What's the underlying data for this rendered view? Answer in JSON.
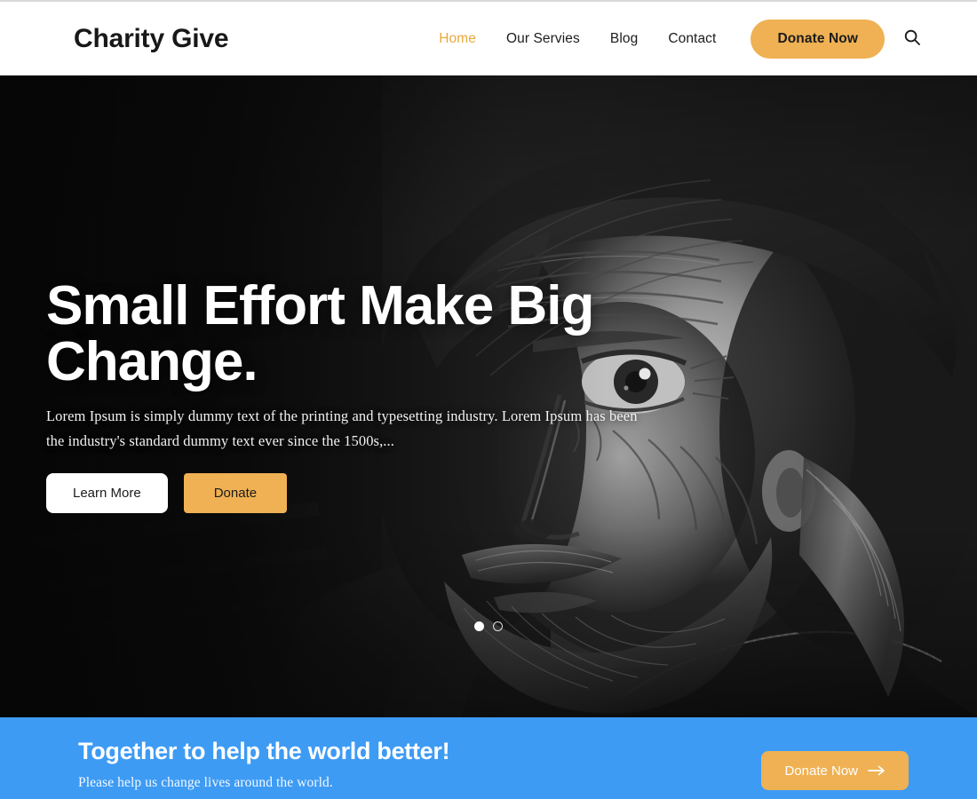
{
  "site": {
    "brand": "Charity Give",
    "accent_orange": "#efb153",
    "accent_blue": "#3d9bf4",
    "active_link_color": "#e9a93c"
  },
  "header": {
    "nav": [
      {
        "label": "Home",
        "active": true
      },
      {
        "label": "Our Servies",
        "active": false
      },
      {
        "label": "Blog",
        "active": false
      },
      {
        "label": "Contact",
        "active": false
      }
    ],
    "donate_label": "Donate Now",
    "search_icon": "search-icon"
  },
  "hero": {
    "title": "Small Effort Make Big Change.",
    "title_line1": "Small Effort Make Big",
    "title_line2": "Change.",
    "paragraph": "Lorem Ipsum is simply dummy text of the printing and typesetting industry. Lorem Ipsum has been the industry's standard dummy text ever since the 1500s,...",
    "primary_button": "Learn More",
    "secondary_button": "Donate",
    "slides": [
      {
        "index": 1,
        "active": true
      },
      {
        "index": 2,
        "active": false
      }
    ],
    "image_alt": "Grayscale portrait of an elderly man wearing a knit beanie"
  },
  "cta": {
    "title": "Together to help the world better!",
    "subtitle": "Please help us change lives around the world.",
    "button_label": "Donate Now",
    "button_icon": "arrow-right-icon"
  }
}
